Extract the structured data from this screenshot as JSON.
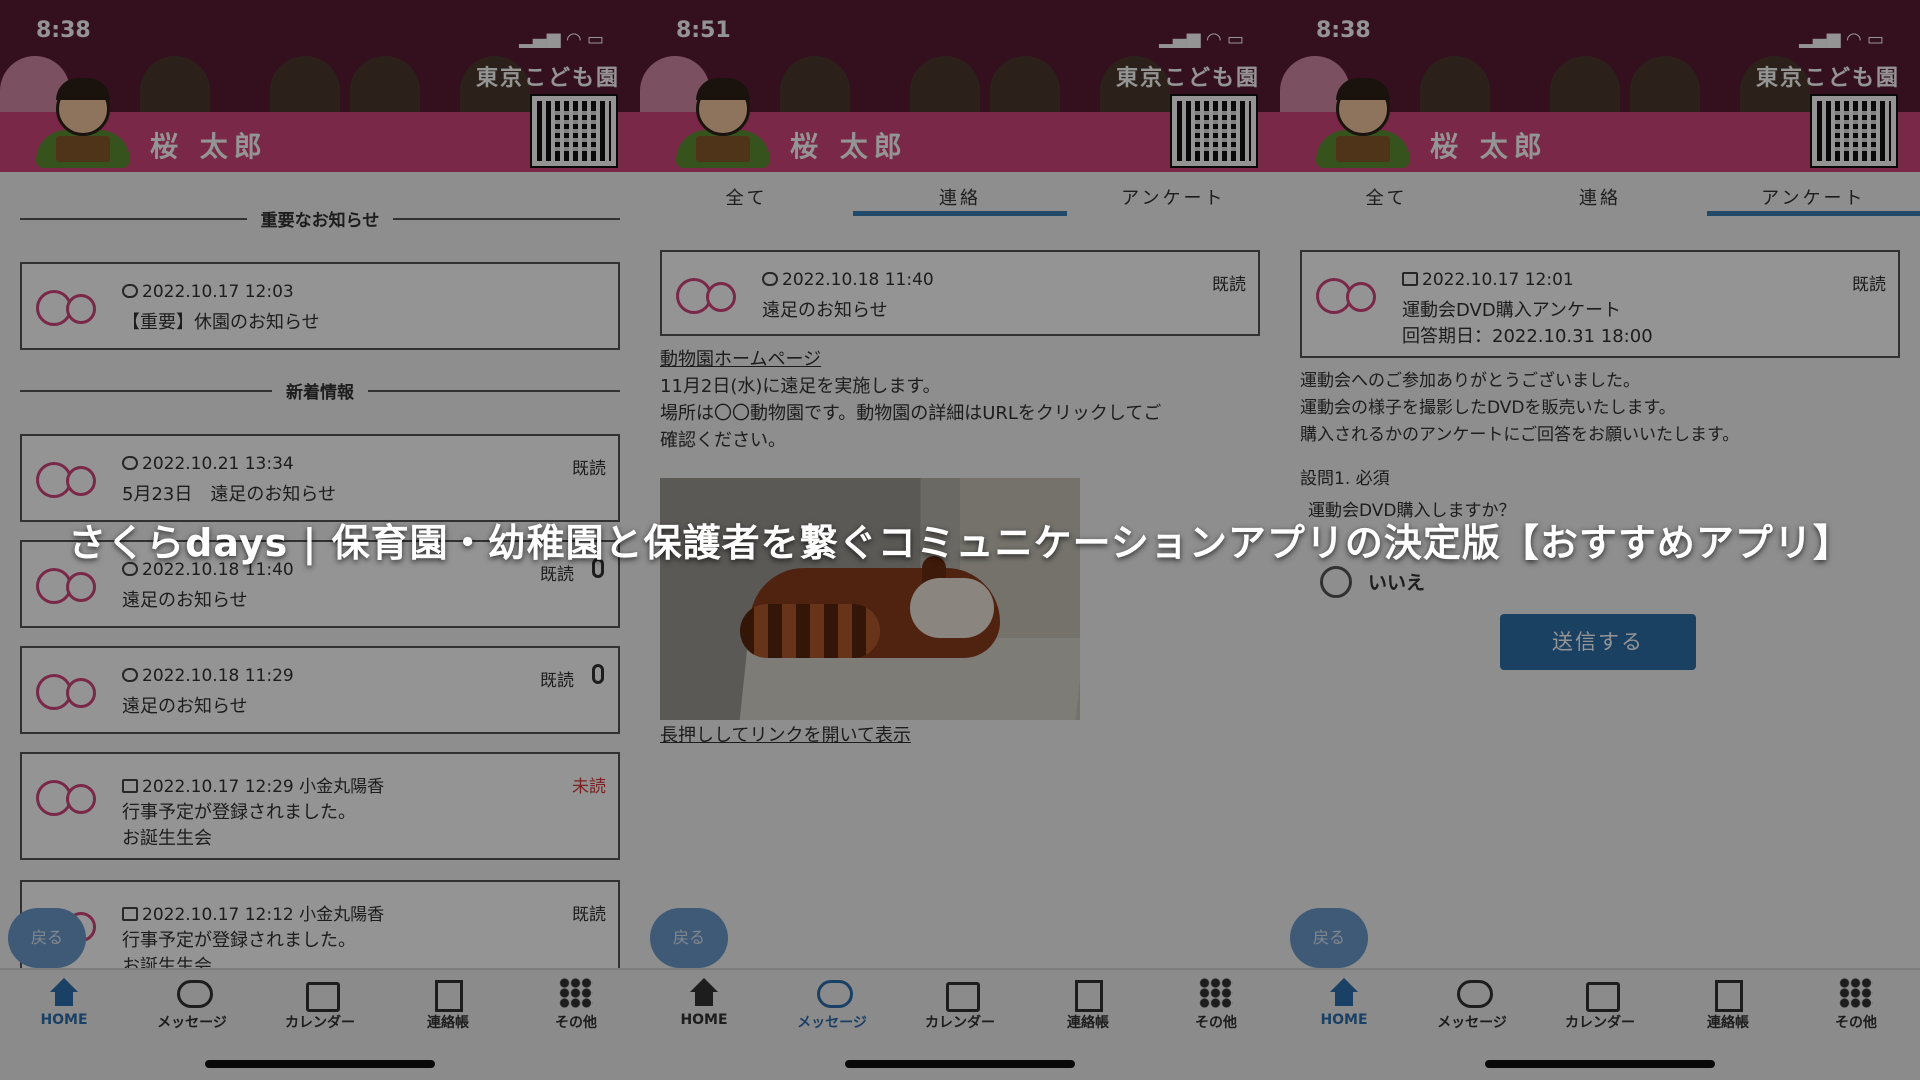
{
  "status": [
    {
      "time": "8:38"
    },
    {
      "time": "8:51"
    },
    {
      "time": "8:38"
    }
  ],
  "header": {
    "school": "東京こども園",
    "child_name": "桜 太郎"
  },
  "screen1": {
    "important_heading": "重要なお知らせ",
    "important": {
      "meta": "2022.10.17 12:03",
      "title": "【重要】休園のお知らせ",
      "status": ""
    },
    "new_heading": "新着情報",
    "items": [
      {
        "meta": "2022.10.21 13:34",
        "title": "5月23日　遠足のお知らせ",
        "line3": "",
        "status": "既読"
      },
      {
        "meta": "2022.10.18 11:40",
        "title": "遠足のお知らせ",
        "line3": "",
        "status": "既読"
      },
      {
        "meta": "2022.10.18 11:29",
        "title": "遠足のお知らせ",
        "line3": "",
        "status": "既読"
      },
      {
        "meta": "2022.10.17 12:29 小金丸陽香",
        "title": "行事予定が登録されました。",
        "line3": "お誕生生会",
        "status": "未読"
      },
      {
        "meta": "2022.10.17 12:12 小金丸陽香",
        "title": "行事予定が登録されました。",
        "line3": "お誕生生会",
        "status": "既読"
      }
    ]
  },
  "tabs": [
    "全て",
    "連絡",
    "アンケート"
  ],
  "screen2": {
    "card": {
      "meta": "2022.10.18 11:40",
      "title": "遠足のお知らせ",
      "status": "既読"
    },
    "link_text": "動物園ホームページ",
    "body_line1": "11月2日(水)に遠足を実施します。",
    "body_line2": "場所は〇〇動物園です。動物園の詳細はURLをクリックしてご",
    "body_line3": "確認ください。",
    "photo_link": "長押ししてリンクを開いて表示"
  },
  "screen3": {
    "card": {
      "meta": "2022.10.17 12:01",
      "title": "運動会DVD購入アンケート",
      "line3": "回答期日：2022.10.31 18:00",
      "status": "既読"
    },
    "body_line1": "運動会へのご参加ありがとうございました。",
    "body_line2": "運動会の様子を撮影したDVDを販売いたします。",
    "body_line3": "購入されるかのアンケートにご回答をお願いいたします。",
    "question_no": "設問1. 必須",
    "question": "運動会DVD購入しますか？",
    "option": "いいえ",
    "submit": "送信する"
  },
  "back_label": "戻る",
  "nav": [
    "HOME",
    "メッセージ",
    "カレンダー",
    "連絡帳",
    "その他"
  ],
  "caption": "さくらdays | 保育園・幼稚園と保護者を繋ぐコミュニケーションアプリの決定版【おすすめアプリ】",
  "colors": {
    "brand_pink": "#d0457a",
    "header_dark": "#5a1c36",
    "accent_blue": "#2f6fae",
    "unread_red": "#d23a3a"
  }
}
